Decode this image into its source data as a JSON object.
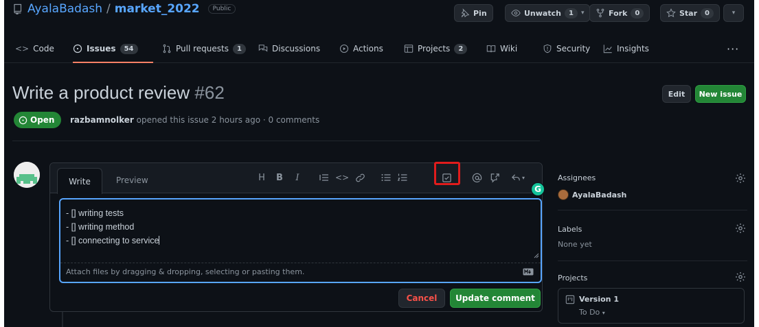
{
  "repo": {
    "owner": "AyalaBadash",
    "separator": "/",
    "name": "market_2022",
    "visibility": "Public",
    "pin_label": "Pin",
    "unwatch_label": "Unwatch",
    "unwatch_count": "1",
    "fork_label": "Fork",
    "fork_count": "0",
    "star_label": "Star",
    "star_count": "0"
  },
  "tabs": [
    {
      "label": "Code",
      "icon": "code-icon"
    },
    {
      "label": "Issues",
      "icon": "issue-opened-icon",
      "count": "54",
      "selected": true
    },
    {
      "label": "Pull requests",
      "icon": "git-pull-request-icon",
      "count": "1"
    },
    {
      "label": "Discussions",
      "icon": "comment-discussion-icon"
    },
    {
      "label": "Actions",
      "icon": "play-icon"
    },
    {
      "label": "Projects",
      "icon": "table-icon",
      "count": "2"
    },
    {
      "label": "Wiki",
      "icon": "book-icon"
    },
    {
      "label": "Security",
      "icon": "shield-icon"
    },
    {
      "label": "Insights",
      "icon": "graph-icon"
    }
  ],
  "issue": {
    "title": "Write a product review",
    "number": "#62",
    "state": "Open",
    "author": "razbamnolker",
    "meta_rest": "opened this issue 2 hours ago · 0 comments",
    "edit_label": "Edit",
    "new_issue_label": "New issue"
  },
  "editor": {
    "write_tab": "Write",
    "preview_tab": "Preview",
    "toolbar": [
      "heading-icon",
      "bold-icon",
      "italic-icon",
      "quote-icon",
      "code-icon",
      "link-icon",
      "unordered-list-icon",
      "ordered-list-icon",
      "tasklist-icon",
      "mention-icon",
      "cross-reference-icon",
      "reply-icon"
    ],
    "toolbar_heading": "H",
    "toolbar_bold": "B",
    "toolbar_italic": "I",
    "lines": {
      "line1_prefix": "- ",
      "line1_box": "[]",
      "line1_text": " writing tests",
      "line2": "- [] writing method",
      "line3": "- [] connecting to service"
    },
    "attach_hint": "Attach files by dragging & dropping, selecting or pasting them.",
    "markdown_badge": "MD",
    "cancel_label": "Cancel",
    "update_label": "Update comment",
    "grammarly_label": "G"
  },
  "sidebar": {
    "assignees_label": "Assignees",
    "assignee_name": "AyalaBadash",
    "labels_label": "Labels",
    "labels_value": "None yet",
    "projects_label": "Projects",
    "project_name": "Version 1",
    "project_status": "To Do"
  },
  "colors": {
    "background": "#0d1117",
    "link": "#58a6ff",
    "success": "#238636",
    "danger": "#f85149",
    "highlight": "#e11c1c",
    "grammarly": "#15c39a"
  }
}
